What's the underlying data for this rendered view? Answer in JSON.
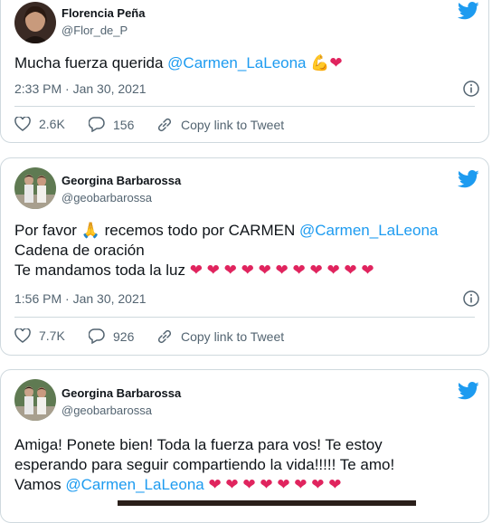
{
  "tweets": [
    {
      "name": "Florencia Peña",
      "handle": "@Flor_de_P",
      "lines": [
        {
          "text": "Mucha fuerza querida ",
          "mention": "@Carmen_LaLeona",
          "emoji": "💪",
          "hearts": "❤"
        }
      ],
      "time": "2:33 PM · Jan 30, 2021",
      "likes": "2.6K",
      "replies": "156",
      "copy_link": "Copy link to Tweet"
    },
    {
      "name": "Georgina Barbarossa",
      "handle": "@geobarbarossa",
      "line1_text": "Por favor ",
      "line1_emoji": "🙏",
      "line1_text2": " recemos todo por CARMEN ",
      "line1_mention": "@Carmen_LaLeona",
      "line2": "Cadena de oración",
      "line3_text": "Te mandamos toda la luz ",
      "line3_hearts": "❤ ❤ ❤ ❤ ❤ ❤ ❤ ❤ ❤ ❤ ❤",
      "time": "1:56 PM · Jan 30, 2021",
      "likes": "7.7K",
      "replies": "926",
      "copy_link": "Copy link to Tweet"
    },
    {
      "name": "Georgina Barbarossa",
      "handle": "@geobarbarossa",
      "line1": "Amiga! Ponete bien! Toda la fuerza para vos! Te estoy",
      "line2": "esperando para seguir compartiendo la vida!!!!! Te amo!",
      "line3_text": "Vamos ",
      "line3_mention": "@Carmen_LaLeona",
      "line3_hearts": " ❤ ❤ ❤ ❤ ❤ ❤ ❤ ❤"
    }
  ],
  "colors": {
    "accent": "#1d9bf0",
    "heart": "#e0245e",
    "muted": "#536471"
  }
}
